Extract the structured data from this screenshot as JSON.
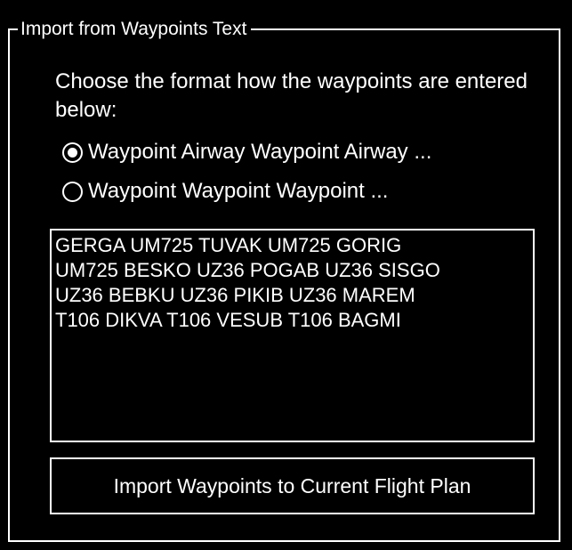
{
  "group": {
    "title": "Import from Waypoints Text"
  },
  "instruction": "Choose the format how the waypoints are entered below:",
  "format_options": [
    {
      "label": "Waypoint Airway Waypoint Airway ...",
      "selected": true
    },
    {
      "label": "Waypoint Waypoint Waypoint ...",
      "selected": false
    }
  ],
  "waypoints_text": {
    "value": "GERGA UM725 TUVAK UM725 GORIG\nUM725 BESKO UZ36 POGAB UZ36 SISGO\nUZ36 BEBKU UZ36 PIKIB UZ36 MAREM\nT106 DIKVA T106 VESUB T106 BAGMI"
  },
  "import_button": {
    "label": "Import Waypoints to Current Flight Plan"
  },
  "colors": {
    "background": "#000000",
    "foreground": "#ffffff"
  },
  "icons": {
    "radio_selected": "radio-button-checked-icon",
    "radio_unselected": "radio-button-unchecked-icon"
  }
}
